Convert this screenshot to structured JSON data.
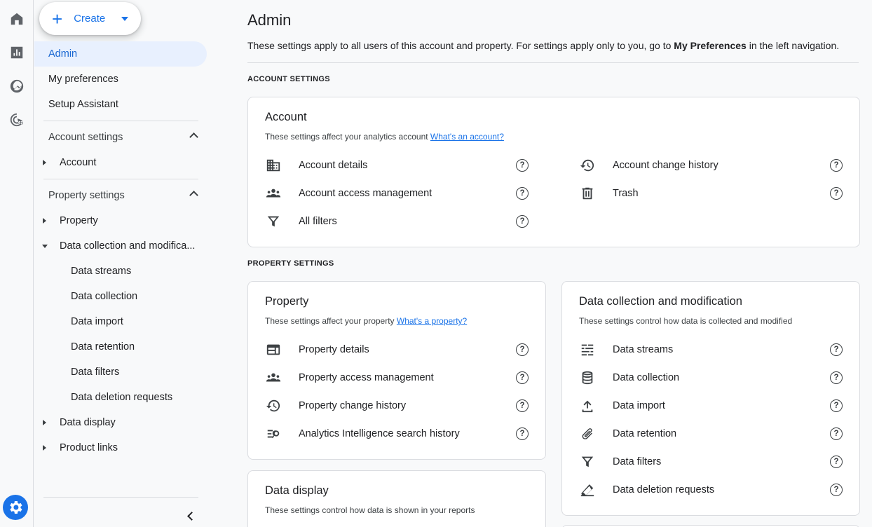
{
  "rail": {
    "items": [
      "home-icon",
      "reports-icon",
      "explore-icon",
      "advertising-icon"
    ],
    "admin_icon": "gear-icon"
  },
  "nav": {
    "create_label": "Create",
    "admin": "Admin",
    "my_preferences": "My preferences",
    "setup_assistant": "Setup Assistant",
    "account_settings": "Account settings",
    "account": "Account",
    "property_settings": "Property settings",
    "property": "Property",
    "data_collection_mod": "Data collection and modifica...",
    "sub": [
      "Data streams",
      "Data collection",
      "Data import",
      "Data retention",
      "Data filters",
      "Data deletion requests"
    ],
    "data_display": "Data display",
    "product_links": "Product links"
  },
  "main": {
    "title": "Admin",
    "desc_pre": "These settings apply to all users of this account and property. For settings apply only to you, go to ",
    "desc_bold": "My Preferences",
    "desc_post": " in the left navigation.",
    "account_section": "ACCOUNT SETTINGS",
    "property_section": "PROPERTY SETTINGS",
    "account_card": {
      "title": "Account",
      "sub": "These settings affect your analytics account ",
      "link": "What's an account?",
      "rows": [
        "Account details",
        "Account access management",
        "All filters",
        "Account change history",
        "Trash"
      ]
    },
    "property_card": {
      "title": "Property",
      "sub": "These settings affect your property ",
      "link": "What's a property?",
      "rows": [
        "Property details",
        "Property access management",
        "Property change history",
        "Analytics Intelligence search history"
      ]
    },
    "dcm_card": {
      "title": "Data collection and modification",
      "sub": "These settings control how data is collected and modified",
      "rows": [
        "Data streams",
        "Data collection",
        "Data import",
        "Data retention",
        "Data filters",
        "Data deletion requests"
      ]
    },
    "display_card": {
      "title": "Data display",
      "sub": "These settings control how data is shown in your reports"
    },
    "help_glyph": "?"
  },
  "colors": {
    "accent": "#1a73e8",
    "active_bg": "#e8f0fe"
  }
}
